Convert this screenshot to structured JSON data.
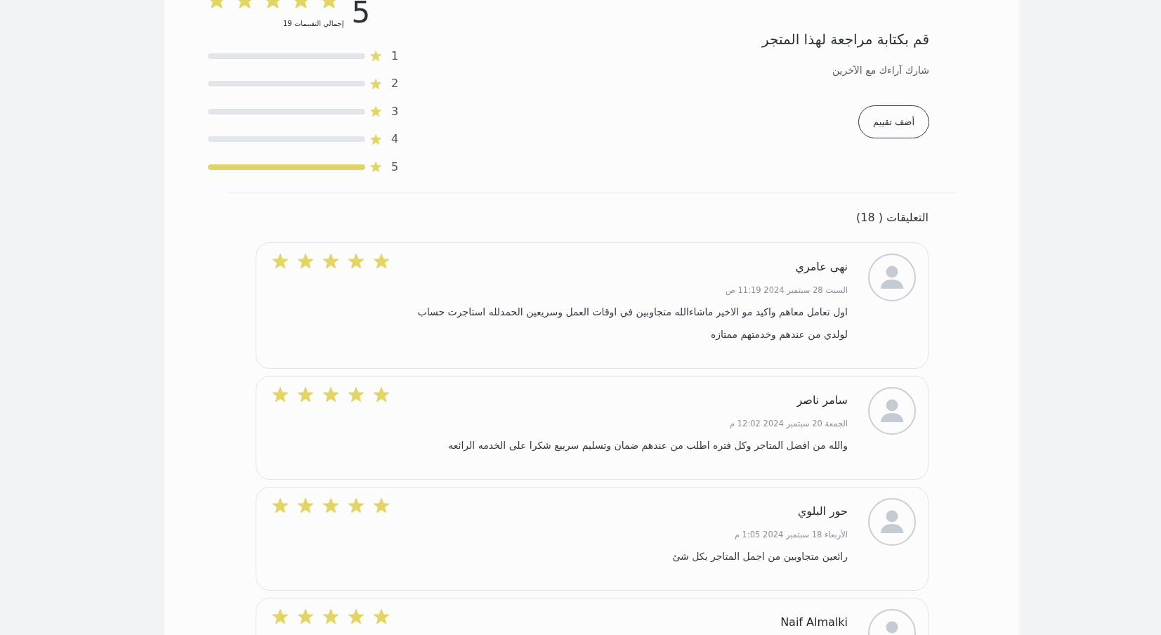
{
  "summary": {
    "stars": 5,
    "average": "5",
    "total": "إجمالي التقييمات 19",
    "distribution": [
      {
        "label": "1",
        "level": 0
      },
      {
        "label": "2",
        "level": 0
      },
      {
        "label": "3",
        "level": 0
      },
      {
        "label": "4",
        "level": 0
      },
      {
        "label": "5",
        "level": 1
      }
    ]
  },
  "write_review": {
    "title": "قم بكتابة مراجعة لهذا المتجر",
    "subtitle": "شارك آراءك مع الآخرين",
    "button": "أضف تقييم"
  },
  "comments": {
    "heading": "التعليقات ( 18)",
    "reviews": [
      {
        "name": "نهى عامري",
        "date": "السبت 28 سبتمبر 2024 11:19 ص",
        "text": "اول تعامل معاهم واكيد مو الاخير ماشاءالله متجاوبين في اوقات العمل وسريعين الحمدلله استاجرت حساب لولدي من عندهم وخدمتهم ممتازه",
        "stars": 5
      },
      {
        "name": "سامر ناصر",
        "date": "الجمعة 20 سبتمبر 2024 12:02 م",
        "text": "والله من افضل المتاجر وكل فتره اطلب من عندهم ضمان وتسليم سرييع شكرا على الخدمه الرائعه",
        "stars": 5
      },
      {
        "name": "حور البلوي",
        "date": "الأربعاء 18 سبتمبر 2024 1:05 م",
        "text": "رائعين متجاوبين من اجمل المتاجر بكل شئ",
        "stars": 5
      },
      {
        "name": "Naif Almalki",
        "stars": 5
      }
    ]
  }
}
